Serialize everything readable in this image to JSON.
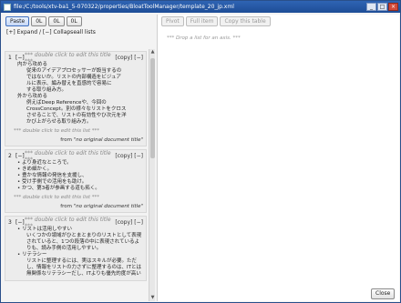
{
  "window": {
    "title": "file:/C:/tools/xtv-ba1_5-070322/properties/BloatToolManager/template_20_jp.xml",
    "buttons": [
      "_",
      "□",
      "×"
    ]
  },
  "left_toolbar": {
    "buttons": [
      "Paste",
      "0L",
      "0L",
      "0L"
    ]
  },
  "expand_row": {
    "expand": "[+]  Expand / [−]  Collapseall lists"
  },
  "lists": [
    {
      "num": "1",
      "toggle": "[−]",
      "title_hint": "*** double click to edit this title ***",
      "actions": "[copy] [−]",
      "items": [
        {
          "lvl": 1,
          "text": "内から攻める"
        },
        {
          "lvl": 2,
          "text": "従来のアイデアプロセッサーが設当するの"
        },
        {
          "lvl": 2,
          "text": "ではないか。リストの内部構造をビジュア"
        },
        {
          "lvl": 2,
          "text": "ルに表示、編み替えを直感的で容易に"
        },
        {
          "lvl": 2,
          "text": "する取り組み方。"
        },
        {
          "lvl": 1,
          "text": "外から攻める"
        },
        {
          "lvl": 2,
          "text": "例えばDeep Referenceや、今回の"
        },
        {
          "lvl": 2,
          "text": "CrossConcept。別の様々なリストをクロス"
        },
        {
          "lvl": 2,
          "text": "させることで、リストの有効性やひ次元を洋"
        },
        {
          "lvl": 2,
          "text": "かび上がらせる取り組み方。"
        }
      ],
      "item_hint": "*** double click to edit this list ***",
      "from": "from",
      "from_title": "\"no original document title\""
    },
    {
      "num": "2",
      "toggle": "[−]",
      "title_hint": "*** double click to edit this title ***",
      "actions": "[copy] [−]",
      "items": [
        {
          "lvl": 1,
          "text": "• より身近なところで。"
        },
        {
          "lvl": 1,
          "text": "• きめ細かく。"
        },
        {
          "lvl": 1,
          "text": "• 豊かな情報の発信を支援し、"
        },
        {
          "lvl": 1,
          "text": "• 受け手側での活用をも助け。"
        },
        {
          "lvl": 1,
          "text": "• かつ、第3者が参画する道も拓く。"
        }
      ],
      "item_hint": "*** double click to edit this list ***",
      "from": "from",
      "from_title": "\"no original document title\""
    },
    {
      "num": "3",
      "toggle": "[−]",
      "title_hint": "*** double click to edit this title ***",
      "actions": "[copy] [−]",
      "items": [
        {
          "lvl": 1,
          "text": "• リストは活用しやすい"
        },
        {
          "lvl": 2,
          "text": "いくつかの領域がひとまとまりのリストとして表現"
        },
        {
          "lvl": 2,
          "text": "されていると、1つの段落の中に表現されているよ"
        },
        {
          "lvl": 2,
          "text": "りも、読み手側の活用しやすい。"
        },
        {
          "lvl": 1,
          "text": "• リテラシー"
        },
        {
          "lvl": 2,
          "text": "リストに整理するには、実はスキルが必要。ただ"
        },
        {
          "lvl": 2,
          "text": "し、情報をリストの力さずに整理するのは、ITとは"
        },
        {
          "lvl": 2,
          "text": "無関係なリテラシーだし、ITよりも優先的度が高い"
        }
      ],
      "item_hint": "",
      "from": "",
      "from_title": ""
    }
  ],
  "right_toolbar": {
    "buttons": [
      "Pivot",
      "Full item",
      "Copy this table"
    ]
  },
  "drop_hint": "*** Drop a list for an axis. ***",
  "close_label": "Close"
}
